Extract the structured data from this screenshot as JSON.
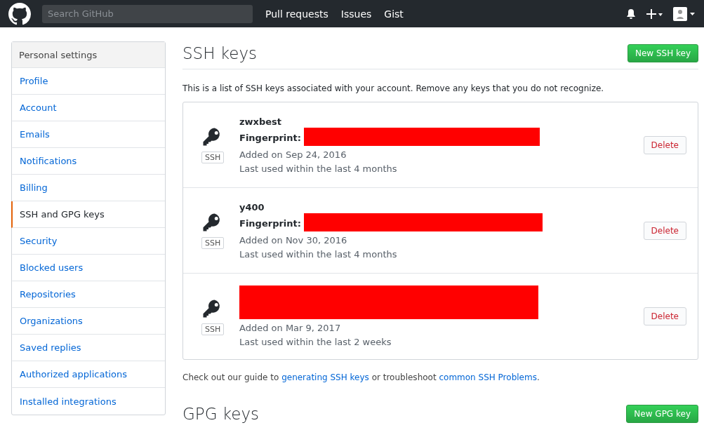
{
  "header": {
    "search": {
      "placeholder": "Search GitHub"
    },
    "nav": [
      "Pull requests",
      "Issues",
      "Gist"
    ]
  },
  "sidebar": {
    "title": "Personal settings",
    "items": [
      {
        "label": "Profile",
        "selected": false
      },
      {
        "label": "Account",
        "selected": false
      },
      {
        "label": "Emails",
        "selected": false
      },
      {
        "label": "Notifications",
        "selected": false
      },
      {
        "label": "Billing",
        "selected": false
      },
      {
        "label": "SSH and GPG keys",
        "selected": true
      },
      {
        "label": "Security",
        "selected": false
      },
      {
        "label": "Blocked users",
        "selected": false
      },
      {
        "label": "Repositories",
        "selected": false
      },
      {
        "label": "Organizations",
        "selected": false
      },
      {
        "label": "Saved replies",
        "selected": false
      },
      {
        "label": "Authorized applications",
        "selected": false
      },
      {
        "label": "Installed integrations",
        "selected": false
      }
    ]
  },
  "ssh": {
    "title": "SSH keys",
    "new_button": "New SSH key",
    "description": "This is a list of SSH keys associated with your account. Remove any keys that you do not recognize.",
    "keys": [
      {
        "badge": "SSH",
        "name": "zwxbest",
        "fingerprint_label": "Fingerprint:",
        "added": "Added on Sep 24, 2016",
        "last_used": "Last used within the last 4 months",
        "delete": "Delete"
      },
      {
        "badge": "SSH",
        "name": "y400",
        "fingerprint_label": "Fingerprint:",
        "added": "Added on Nov 30, 2016",
        "last_used": "Last used within the last 4 months",
        "delete": "Delete"
      },
      {
        "badge": "SSH",
        "added": "Added on Mar 9, 2017",
        "last_used": "Last used within the last 2 weeks",
        "delete": "Delete"
      }
    ],
    "footer": {
      "before": "Check out our guide to ",
      "link1": "generating SSH keys",
      "middle": " or troubleshoot ",
      "link2": "common SSH Problems",
      "after": "."
    }
  },
  "gpg": {
    "title": "GPG keys",
    "new_button": "New GPG key"
  }
}
